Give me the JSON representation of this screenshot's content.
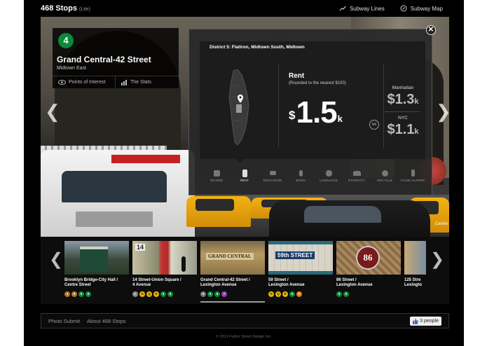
{
  "header": {
    "brand": "468 Stops",
    "brand_suffix": "(Lite)",
    "nav": [
      {
        "label": "Subway Lines",
        "icon": "route-icon"
      },
      {
        "label": "Subway Map",
        "icon": "compass-icon"
      }
    ]
  },
  "hero": {
    "caption": "Centre"
  },
  "station": {
    "line": "4",
    "line_color": "#0a8a3a",
    "name": "Grand Central-42 Street",
    "neighborhood": "Midtown East",
    "tabs": [
      {
        "label": "Points of Interest",
        "icon": "eye-icon"
      },
      {
        "label": "The Stats",
        "icon": "bar-chart-icon"
      }
    ]
  },
  "stats": {
    "district": "District 5: Flatiron, Midtown South, Midtown",
    "metric": "Rent",
    "metric_note": "(Rounded to the nearest $100)",
    "currency": "$",
    "value": "1.5",
    "unit": "k",
    "vs": "vs",
    "comparisons": [
      {
        "label": "Manhattan",
        "currency": "$",
        "value": "1.3",
        "unit": "k"
      },
      {
        "label": "NYC",
        "currency": "$",
        "value": "1.1",
        "unit": "k"
      }
    ],
    "categories": [
      "INCOME",
      "RENT",
      "EDUCATION",
      "BORN",
      "LANGUAGE",
      "ETHNICITY",
      "RECYCLE",
      "FALSE ALARMS"
    ],
    "active_category": "RENT"
  },
  "strip": {
    "items": [
      {
        "line1": "Brooklyn Bridge-City Hall /",
        "line2": "Centre Street",
        "lines": [
          {
            "t": "J",
            "c": "#b5762a"
          },
          {
            "t": "Z",
            "c": "#b5762a"
          },
          {
            "t": "5",
            "c": "#0a8a3a"
          },
          {
            "t": "6",
            "c": "#0a8a3a"
          }
        ],
        "sign": ""
      },
      {
        "line1": "14 Street-Union Square /",
        "line2": "4 Avenue",
        "lines": [
          {
            "t": "L",
            "c": "#888"
          },
          {
            "t": "N",
            "c": "#e8b500"
          },
          {
            "t": "Q",
            "c": "#e8b500"
          },
          {
            "t": "R",
            "c": "#e8b500"
          },
          {
            "t": "5",
            "c": "#0a8a3a"
          },
          {
            "t": "6",
            "c": "#0a8a3a"
          }
        ],
        "sign": "14"
      },
      {
        "line1": "Grand Central-42 Street /",
        "line2": "Lexington Avenue",
        "lines": [
          {
            "t": "S",
            "c": "#777"
          },
          {
            "t": "5",
            "c": "#0a8a3a"
          },
          {
            "t": "6",
            "c": "#0a8a3a"
          },
          {
            "t": "7",
            "c": "#9a3ab5"
          }
        ],
        "sign": "GRAND CENTRAL"
      },
      {
        "line1": "59 Street /",
        "line2": "Lexington Avenue",
        "lines": [
          {
            "t": "N",
            "c": "#e8b500"
          },
          {
            "t": "Q",
            "c": "#e8b500"
          },
          {
            "t": "R",
            "c": "#e8b500"
          },
          {
            "t": "5",
            "c": "#0a8a3a"
          },
          {
            "t": "F",
            "c": "#f07a0a"
          }
        ],
        "sign": "59th STREET"
      },
      {
        "line1": "86 Street /",
        "line2": "Lexington Avenue",
        "lines": [
          {
            "t": "5",
            "c": "#0a8a3a"
          },
          {
            "t": "6",
            "c": "#0a8a3a"
          }
        ],
        "sign": "86"
      },
      {
        "line1": "125 Stre",
        "line2": "Lexingto",
        "lines": [],
        "sign": ""
      }
    ]
  },
  "footer": {
    "links": [
      "Photo Submit",
      "About 468 Stops"
    ],
    "like_count": "3 people",
    "copyright": "© 2011 Fulton Street Design Inc."
  }
}
